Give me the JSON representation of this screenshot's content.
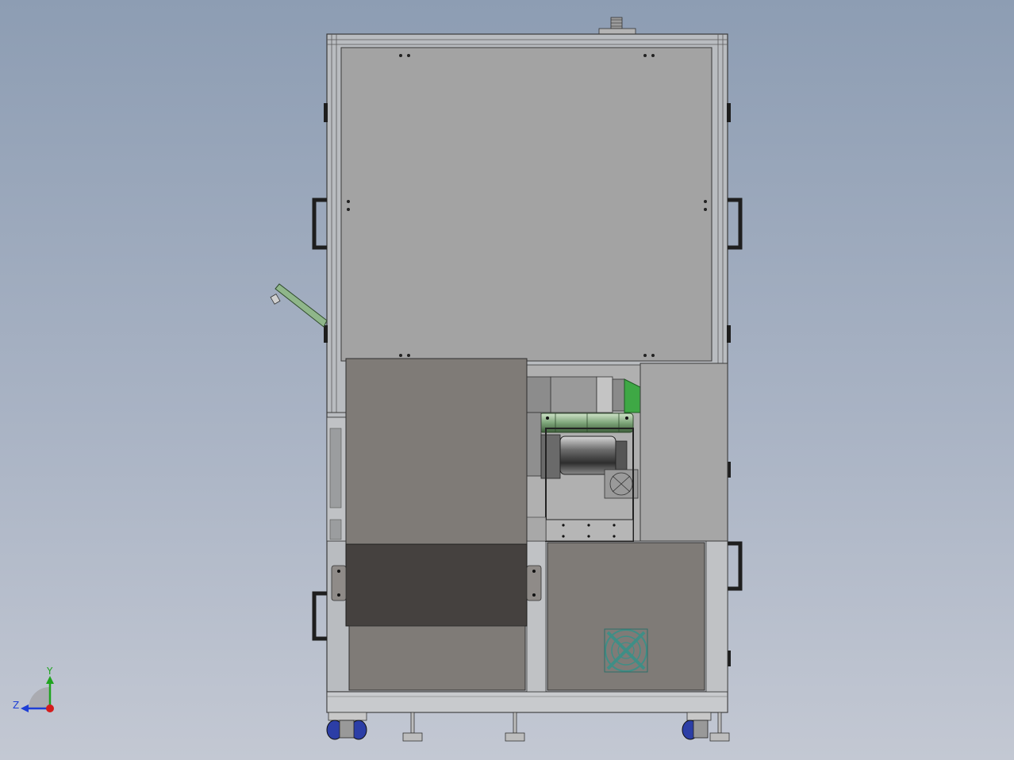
{
  "view": {
    "background_top": "#8d9db3",
    "background_bottom": "#c3c8d3"
  },
  "triad": {
    "y_label": "Y",
    "z_label": "Z",
    "y_color": "#1fa31f",
    "z_color": "#1e3fd6",
    "x_color": "#d41c1c"
  },
  "palette": {
    "frame": "#b9bcc0",
    "frame_edge": "#3a3a3a",
    "upper_panel": "#a3a3a3",
    "lower_panel": "#7f7b77",
    "dark_panel": "#45413f",
    "side_panel": "#a6a6a6",
    "handle": "#2a2a2a",
    "fan": "#3f8e86",
    "green_part": "#7ea57a",
    "caster_blue": "#2c3ea6"
  }
}
